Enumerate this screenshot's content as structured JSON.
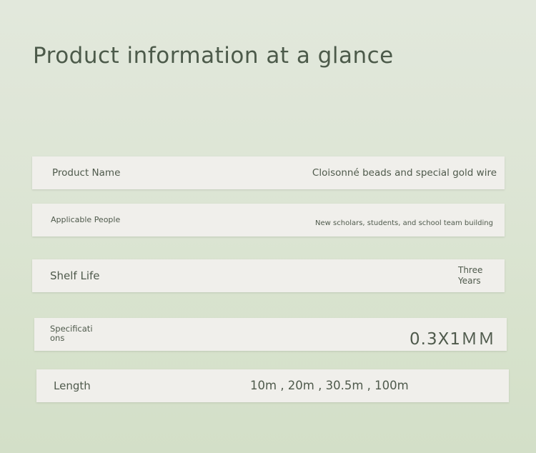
{
  "title": "Product information at a glance",
  "rows": [
    {
      "label": "Product Name",
      "value": "Cloisonné beads and special gold wire"
    },
    {
      "label": "Applicable People",
      "value": "New scholars, students, and school team building"
    },
    {
      "label": "Shelf Life",
      "value": "Three Years"
    },
    {
      "label": "Specifications",
      "value": "0.3X1ＭＭ"
    },
    {
      "label": "Length",
      "value": "10m , 20m , 30.5m , 100m"
    }
  ]
}
